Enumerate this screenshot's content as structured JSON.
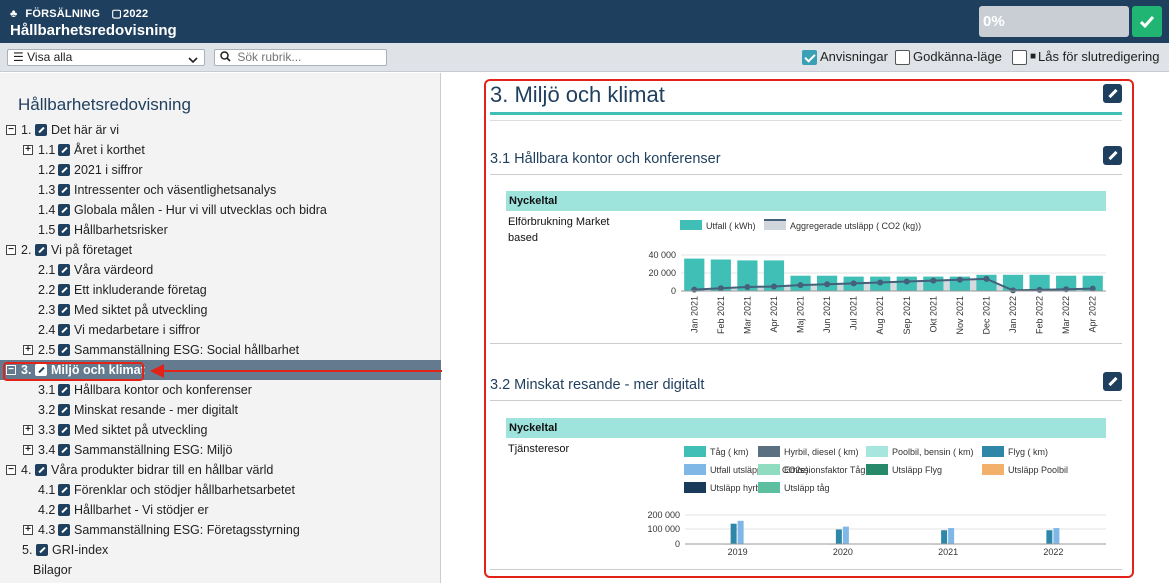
{
  "header": {
    "sales_label": "FÖRSÄLNING",
    "year": "2022",
    "title": "Hållbarhetsredovisning",
    "progress": "0%"
  },
  "toolbar": {
    "filter_value": "Visa alla",
    "search_placeholder": "Sök rubrik...",
    "toggles": {
      "anvisningar": "Anvisningar",
      "godkanna": "Godkänna-läge",
      "las": "Lås för slutredigering"
    }
  },
  "sidebar": {
    "title": "Hållbarhetsredovisning",
    "items": [
      {
        "num": "1.",
        "label": "Det här är vi"
      },
      {
        "num": "1.1",
        "label": "Året i korthet"
      },
      {
        "num": "1.2",
        "label": "2021 i siffror"
      },
      {
        "num": "1.3",
        "label": "Intressenter och väsentlighetsanalys"
      },
      {
        "num": "1.4",
        "label": "Globala målen - Hur vi vill utvecklas och bidra"
      },
      {
        "num": "1.5",
        "label": "Hållbarhetsrisker"
      },
      {
        "num": "2.",
        "label": "Vi på företaget"
      },
      {
        "num": "2.1",
        "label": "Våra värdeord"
      },
      {
        "num": "2.2",
        "label": "Ett inkluderande företag"
      },
      {
        "num": "2.3",
        "label": "Med siktet på utveckling"
      },
      {
        "num": "2.4",
        "label": "Vi medarbetare i siffror"
      },
      {
        "num": "2.5",
        "label": "Sammanställning ESG: Social hållbarhet"
      },
      {
        "num": "3.",
        "label": "Miljö och klimat"
      },
      {
        "num": "3.1",
        "label": "Hållbara kontor och konferenser"
      },
      {
        "num": "3.2",
        "label": "Minskat resande - mer digitalt"
      },
      {
        "num": "3.3",
        "label": "Med siktet på utveckling"
      },
      {
        "num": "3.4",
        "label": "Sammanställning ESG: Miljö"
      },
      {
        "num": "4.",
        "label": "Våra produkter bidrar till en hållbar värld"
      },
      {
        "num": "4.1",
        "label": "Förenklar och stödjer hållbarhetsarbetet"
      },
      {
        "num": "4.2",
        "label": "Hållbarhet - Vi stödjer er"
      },
      {
        "num": "4.3",
        "label": "Sammanställning ESG: Företagsstyrning"
      },
      {
        "num": "5.",
        "label": "GRI-index"
      },
      {
        "num": "",
        "label": "Bilagor"
      }
    ]
  },
  "content": {
    "section_title": "3. Miljö och klimat",
    "sub1": "3.1 Hållbara kontor och konferenser",
    "sub2": "3.2 Minskat resande - mer digitalt",
    "nyckeltal": "Nyckeltal",
    "kpi1": "Elförbrukning Market based",
    "kpi2": "Tjänsteresor"
  },
  "colors": {
    "header": "#1f3f5e",
    "accent": "#3fbfb6",
    "highlight": "#e2231a",
    "ok": "#21b573"
  },
  "chart_data": [
    {
      "type": "bar",
      "legend": [
        "Utfall ( kWh)",
        "Aggregerade utsläpp ( CO2 (kg))"
      ],
      "categories": [
        "Jan 2021",
        "Feb 2021",
        "Mar 2021",
        "Apr 2021",
        "Maj 2021",
        "Jun 2021",
        "Jul 2021",
        "Aug 2021",
        "Sep 2021",
        "Okt 2021",
        "Nov 2021",
        "Dec 2021",
        "Jan 2022",
        "Feb 2022",
        "Mar 2022",
        "Apr 2022"
      ],
      "series": [
        {
          "name": "Utfall ( kWh)",
          "type": "bar",
          "values": [
            36000,
            35000,
            34000,
            34000,
            17000,
            17000,
            16000,
            16000,
            16000,
            16000,
            16000,
            18000,
            18000,
            18000,
            17000,
            17000
          ]
        },
        {
          "name": "Aggregerade utsläpp ( CO2 (kg))",
          "type": "area",
          "values": [
            1500,
            3000,
            4500,
            5000,
            6500,
            7500,
            8500,
            9500,
            10500,
            11500,
            12500,
            13500,
            700,
            1300,
            2000,
            2600
          ]
        }
      ],
      "yticks": [
        "40 000",
        "20 000",
        "0"
      ],
      "ylim": [
        0,
        40000
      ]
    },
    {
      "type": "bar",
      "legend": [
        "Tåg ( km)",
        "Hyrbil, diesel ( km)",
        "Poolbil, bensin ( km)",
        "Flyg ( km)",
        "Utfall utsläpp ( kg CO2e)",
        "Emissionsfaktor Tåg",
        "Utsläpp Flyg",
        "Utsläpp Poolbil",
        "Utsläpp hyrbil",
        "Utsläpp tåg"
      ],
      "categories": [
        "2019",
        "2020",
        "2021",
        "2022"
      ],
      "series": [
        {
          "name": "Flyg ( km)",
          "values": [
            140000,
            100000,
            95000,
            95000
          ]
        },
        {
          "name": "Utfall utsläpp ( kg CO2e)",
          "values": [
            160000,
            120000,
            110000,
            110000
          ]
        },
        {
          "name": "Tåg ( km)",
          "values": [
            3000,
            3000,
            3000,
            3000
          ]
        }
      ],
      "yticks": [
        "200 000",
        "100 000",
        "0"
      ],
      "ylim": [
        0,
        200000
      ]
    }
  ]
}
